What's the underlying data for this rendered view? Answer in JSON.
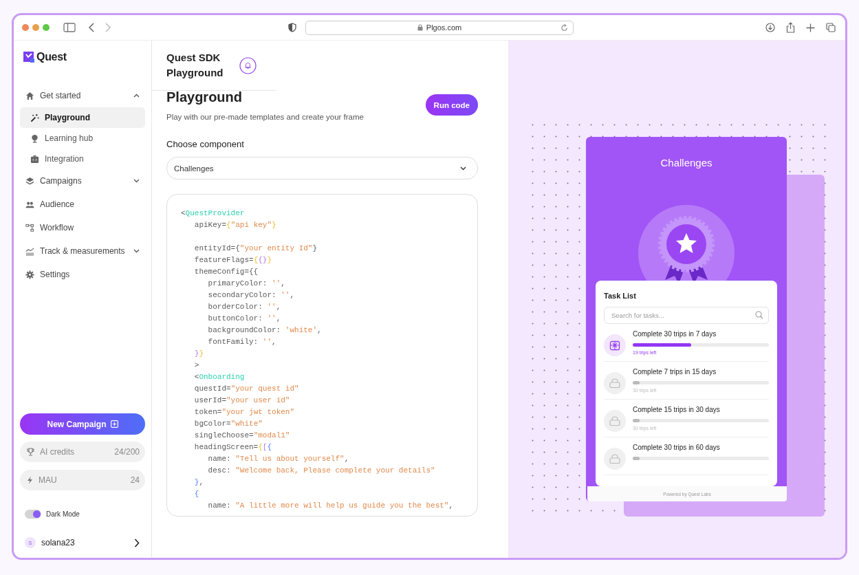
{
  "browser": {
    "url": "Plgos.com"
  },
  "sidebar": {
    "brand": "Quest",
    "nav": [
      {
        "label": "Get started",
        "expanded": true,
        "children": [
          {
            "label": "Playground",
            "selected": true
          },
          {
            "label": "Learning hub",
            "selected": false
          },
          {
            "label": "Integration",
            "selected": false
          }
        ]
      },
      {
        "label": "Campaigns",
        "expanded": false
      },
      {
        "label": "Audience"
      },
      {
        "label": "Workflow"
      },
      {
        "label": "Track & measurements",
        "expanded": false
      },
      {
        "label": "Settings"
      }
    ],
    "new_campaign": "New Campaign",
    "stats": [
      {
        "label": "AI credits",
        "value": "24/200"
      },
      {
        "label": "MAU",
        "value": "24"
      }
    ],
    "dark_mode": {
      "label": "Dark Mode",
      "on": true
    },
    "user": {
      "initial": "S",
      "name": "solana23"
    }
  },
  "main": {
    "header_title": "Quest SDK Playground",
    "title": "Playground",
    "subtitle": "Play with our pre-made templates and create your frame",
    "run_button": "Run code",
    "component_label": "Choose component",
    "component_value": "Challenges",
    "code": [
      {
        "tokens": [
          {
            "kind": "plain",
            "text": "<"
          },
          {
            "kind": "tag",
            "text": "QuestProvider"
          }
        ]
      },
      {
        "tokens": [
          {
            "kind": "plain",
            "text": "   apiKey="
          },
          {
            "kind": "bracket1",
            "text": "{"
          },
          {
            "kind": "string",
            "text": "\"api key\""
          },
          {
            "kind": "bracket1",
            "text": "}"
          }
        ]
      },
      {
        "blank_before": true,
        "tokens": [
          {
            "kind": "plain",
            "text": "   entityId={"
          },
          {
            "kind": "string",
            "text": "\"your entity Id\""
          },
          {
            "kind": "plain",
            "text": "}"
          }
        ]
      },
      {
        "tokens": [
          {
            "kind": "plain",
            "text": "   featureFlags="
          },
          {
            "kind": "bracket1",
            "text": "{"
          },
          {
            "kind": "bracket2",
            "text": "{}"
          },
          {
            "kind": "bracket1",
            "text": "}"
          }
        ]
      },
      {
        "tokens": [
          {
            "kind": "plain",
            "text": "   themeConfig={{"
          }
        ]
      },
      {
        "tokens": [
          {
            "kind": "plain",
            "text": "      primaryColor: "
          },
          {
            "kind": "string",
            "text": "''"
          },
          {
            "kind": "plain",
            "text": ","
          }
        ]
      },
      {
        "tokens": [
          {
            "kind": "plain",
            "text": "      secondaryColor: "
          },
          {
            "kind": "string",
            "text": "''"
          },
          {
            "kind": "plain",
            "text": ","
          }
        ]
      },
      {
        "tokens": [
          {
            "kind": "plain",
            "text": "      borderColor: "
          },
          {
            "kind": "string",
            "text": "''"
          },
          {
            "kind": "plain",
            "text": ","
          }
        ]
      },
      {
        "tokens": [
          {
            "kind": "plain",
            "text": "      buttonColor: "
          },
          {
            "kind": "string",
            "text": "''"
          },
          {
            "kind": "plain",
            "text": ","
          }
        ]
      },
      {
        "tokens": [
          {
            "kind": "plain",
            "text": "      backgroundColor: "
          },
          {
            "kind": "string",
            "text": "'white'"
          },
          {
            "kind": "plain",
            "text": ","
          }
        ]
      },
      {
        "tokens": [
          {
            "kind": "plain",
            "text": "      fontFamily: "
          },
          {
            "kind": "string",
            "text": "''"
          },
          {
            "kind": "plain",
            "text": ","
          }
        ]
      },
      {
        "tokens": [
          {
            "kind": "bracket2",
            "text": "   }"
          },
          {
            "kind": "bracket1",
            "text": "}"
          }
        ]
      },
      {
        "tokens": [
          {
            "kind": "plain",
            "text": "   >"
          }
        ]
      },
      {
        "tokens": [
          {
            "kind": "plain",
            "text": "   <"
          },
          {
            "kind": "tag",
            "text": "Onboarding"
          }
        ]
      },
      {
        "tokens": [
          {
            "kind": "plain",
            "text": "   questId="
          },
          {
            "kind": "string",
            "text": "\"your quest id\""
          }
        ]
      },
      {
        "tokens": [
          {
            "kind": "plain",
            "text": "   userId="
          },
          {
            "kind": "string",
            "text": "\"your user id\""
          }
        ]
      },
      {
        "tokens": [
          {
            "kind": "plain",
            "text": "   token="
          },
          {
            "kind": "string",
            "text": "\"your jwt token\""
          }
        ]
      },
      {
        "tokens": [
          {
            "kind": "plain",
            "text": "   bgColor="
          },
          {
            "kind": "string",
            "text": "\"white\""
          }
        ]
      },
      {
        "tokens": [
          {
            "kind": "plain",
            "text": "   singleChoose="
          },
          {
            "kind": "string",
            "text": "\"modal1\""
          }
        ]
      },
      {
        "tokens": [
          {
            "kind": "plain",
            "text": "   headingScreen="
          },
          {
            "kind": "bracket1",
            "text": "{"
          },
          {
            "kind": "bracket2",
            "text": "["
          },
          {
            "kind": "bracket3",
            "text": "{"
          }
        ]
      },
      {
        "tokens": [
          {
            "kind": "plain",
            "text": "      name: "
          },
          {
            "kind": "string",
            "text": "\"Tell us about yourself\""
          },
          {
            "kind": "plain",
            "text": ","
          }
        ]
      },
      {
        "tokens": [
          {
            "kind": "plain",
            "text": "      desc: "
          },
          {
            "kind": "string",
            "text": "\"Welcome back, Please complete your details\""
          }
        ]
      },
      {
        "tokens": [
          {
            "kind": "bracket3",
            "text": "   }"
          },
          {
            "kind": "plain",
            "text": ","
          }
        ]
      },
      {
        "tokens": [
          {
            "kind": "bracket3",
            "text": "   {"
          }
        ]
      },
      {
        "tokens": [
          {
            "kind": "plain",
            "text": "      name: "
          },
          {
            "kind": "string",
            "text": "\"A little more will help us guide you the best\""
          },
          {
            "kind": "plain",
            "text": ","
          }
        ]
      }
    ]
  },
  "preview": {
    "title": "Challenges",
    "task_list_title": "Task List",
    "search_placeholder": "Search for tasks...",
    "tasks": [
      {
        "title": "Complete 30 trips in 7 days",
        "level": 0.43,
        "remaining": "19 trips left",
        "unlocked": true
      },
      {
        "title": "Complete 7 trips in 15 days",
        "level": 0.05,
        "remaining": "30 trips left",
        "unlocked": false
      },
      {
        "title": "Complete 15 trips in 30 days",
        "level": 0.05,
        "remaining": "30 trips left",
        "unlocked": false
      },
      {
        "title": "Complete 30 trips in 60 days",
        "level": 0.05,
        "unlocked": false
      }
    ],
    "footer": "Powered by Quest Labs"
  }
}
